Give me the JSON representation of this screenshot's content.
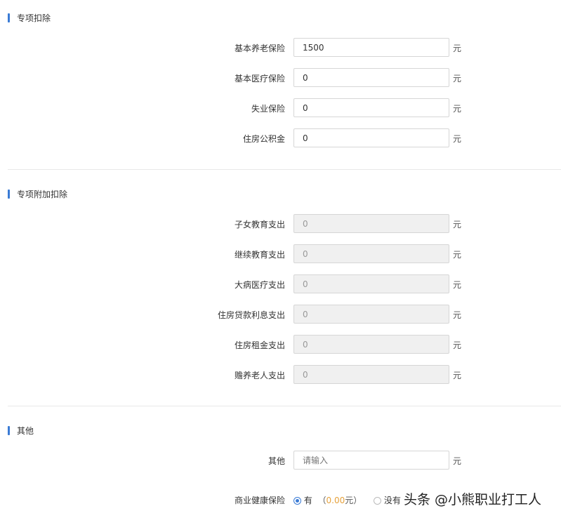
{
  "sections": [
    {
      "title": "专项扣除",
      "rows": [
        {
          "label": "基本养老保险",
          "value": "1500",
          "unit": "元"
        },
        {
          "label": "基本医疗保险",
          "value": "0",
          "unit": "元"
        },
        {
          "label": "失业保险",
          "value": "0",
          "unit": "元"
        },
        {
          "label": "住房公积金",
          "value": "0",
          "unit": "元"
        }
      ]
    },
    {
      "title": "专项附加扣除",
      "rows": [
        {
          "label": "子女教育支出",
          "value": "0",
          "unit": "元"
        },
        {
          "label": "继续教育支出",
          "value": "0",
          "unit": "元"
        },
        {
          "label": "大病医疗支出",
          "value": "0",
          "unit": "元"
        },
        {
          "label": "住房贷款利息支出",
          "value": "0",
          "unit": "元"
        },
        {
          "label": "住房租金支出",
          "value": "0",
          "unit": "元"
        },
        {
          "label": "赡养老人支出",
          "value": "0",
          "unit": "元"
        }
      ]
    },
    {
      "title": "其他",
      "rows": [
        {
          "label": "其他",
          "placeholder": "请输入",
          "unit": "元"
        }
      ]
    }
  ],
  "health": {
    "label": "商业健康保险",
    "yes": "有",
    "amount_open": "（",
    "amount": "0.00",
    "amount_unit": "元）",
    "no": "没有"
  },
  "watermark": "头条 @小熊职业打工人",
  "colors": {
    "accent": "#3a7bd5",
    "amount": "#e6a23c"
  }
}
